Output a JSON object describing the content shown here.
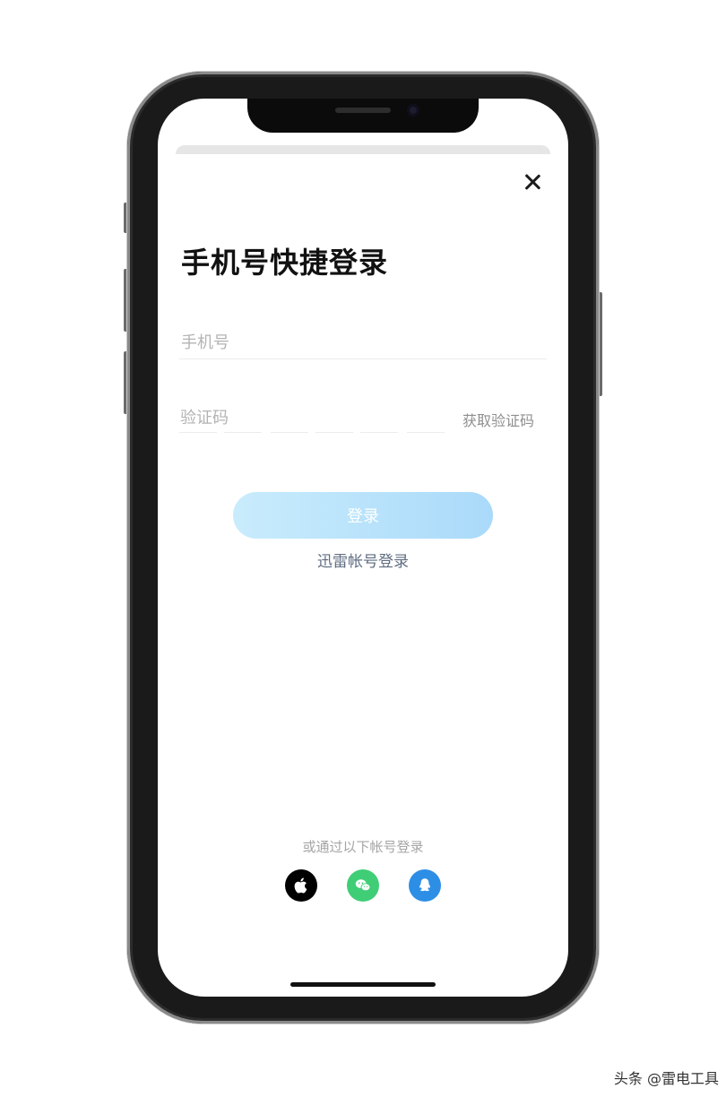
{
  "page": {
    "title": "手机号快捷登录",
    "close_icon": "close-icon"
  },
  "form": {
    "phone_placeholder": "手机号",
    "phone_value": "",
    "code_label": "验证码",
    "get_code_label": "获取验证码",
    "login_label": "登录",
    "alt_login_label": "迅雷帐号登录"
  },
  "social": {
    "caption": "或通过以下帐号登录",
    "providers": [
      {
        "icon": "apple-icon",
        "color": "#000000"
      },
      {
        "icon": "wechat-icon",
        "color": "#3fce76"
      },
      {
        "icon": "qq-icon",
        "color": "#2d8ee6"
      }
    ]
  },
  "colors": {
    "login_button": "#bfe6fb",
    "alt_login_text": "#5f6c80"
  },
  "watermark": "头条 @雷电工具"
}
